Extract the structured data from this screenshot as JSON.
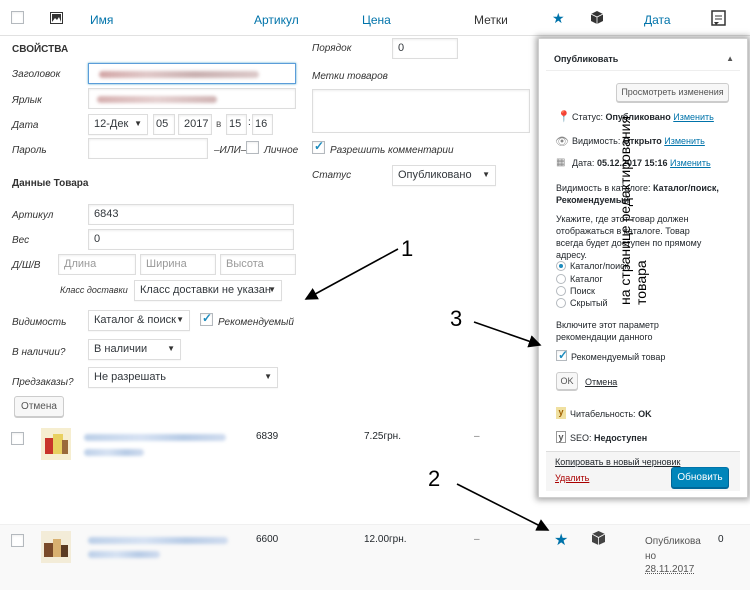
{
  "header": {
    "name_col": "Имя",
    "sku_col": "Артикул",
    "price_col": "Цена",
    "tags_col": "Метки",
    "date_col": "Дата"
  },
  "quick_edit": {
    "title": "СВОЙСТВА",
    "heading_label": "Заголовок",
    "slug_label": "Ярлык",
    "date_label": "Дата",
    "date_month": "12-Дек",
    "date_day": "05",
    "date_year": "2017",
    "date_at": "в",
    "date_hour": "15",
    "date_min": "16",
    "password_label": "Пароль",
    "or_text": "–ИЛИ–",
    "private_label": "Личное",
    "order_label": "Порядок",
    "order_value": "0",
    "tags_label": "Метки товаров",
    "allow_comments_label": "Разрешить комментарии",
    "status_label": "Статус",
    "status_value": "Опубликовано",
    "product_data_title": "Данные Товара",
    "sku_label": "Артикул",
    "sku_value": "6843",
    "weight_label": "Вес",
    "weight_value": "0",
    "dims_label": "Д/Ш/В",
    "length_ph": "Длина",
    "width_ph": "Ширина",
    "height_ph": "Высота",
    "shipping_class_label": "Класс доставки",
    "shipping_class_value": "Класс доставки не указан",
    "visibility_label": "Видимость",
    "visibility_value": "Каталог & поиск",
    "featured_label": "Рекомендуемый",
    "in_stock_label": "В наличии?",
    "in_stock_value": "В наличии",
    "backorders_label": "Предзаказы?",
    "backorders_value": "Не разрешать",
    "cancel_label": "Отмена"
  },
  "rows": [
    {
      "sku": "6839",
      "price": "7.25грн.",
      "tags": "–"
    },
    {
      "sku": "6600",
      "price": "12.00грн.",
      "tags": "–",
      "status": "Опубликова\nно",
      "date": "28.11.2017",
      "count": "0"
    }
  ],
  "publish": {
    "title": "Опубликовать",
    "preview_btn": "Просмотреть изменения",
    "status_label": "Статус:",
    "status_value": "Опубликовано",
    "change": "Изменить",
    "visibility_label": "Видимость:",
    "visibility_value": "Открыто",
    "date_label": "Дата:",
    "date_value": "05.12.2017 15:16",
    "catalog_vis_label": "Видимость в каталоге:",
    "catalog_vis_value": "Каталог/поиск, Рекомендуемый",
    "help_text": "Укажите, где этот товар должен отображаться в каталоге. Товар всегда будет доступен по прямому адресу.",
    "options": [
      "Каталог/поиск",
      "Каталог",
      "Поиск",
      "Скрытый"
    ],
    "featured_help": "Включите этот параметр рекомендации данного",
    "featured_label": "Рекомендуемый товар",
    "ok_btn": "OK",
    "cancel_link": "Отмена",
    "readability_label": "Читабельность:",
    "readability_value": "OK",
    "seo_label": "SEO:",
    "seo_value": "Недоступен",
    "copy_link": "Копировать в новый черновик",
    "delete_link": "Удалить",
    "update_btn": "Обновить"
  },
  "annotations": {
    "n1": "1",
    "n2": "2",
    "n3": "3",
    "rotated": "на странице редактирования товара"
  }
}
